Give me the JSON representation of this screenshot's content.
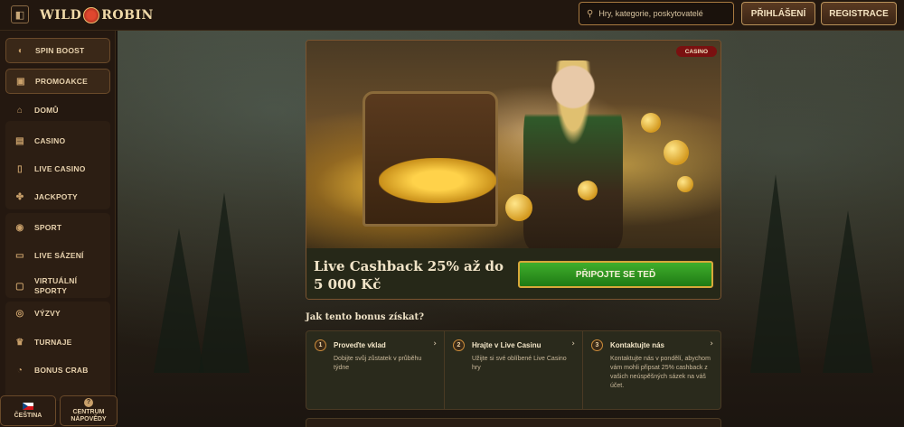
{
  "header": {
    "logo_text_left": "WILD",
    "logo_text_right": "ROBIN",
    "search_placeholder": "Hry, kategorie, poskytovatelé",
    "login_label": "PŘIHLÁŠENÍ",
    "register_label": "REGISTRACE"
  },
  "sidebar": {
    "items": [
      {
        "label": "SPIN BOOST",
        "icon": "spin-icon"
      },
      {
        "label": "PROMOAKCE",
        "icon": "gift-icon"
      },
      {
        "label": "DOMŮ",
        "icon": "home-icon"
      },
      {
        "label": "CASINO",
        "icon": "slot-icon"
      },
      {
        "label": "LIVE CASINO",
        "icon": "cards-icon"
      },
      {
        "label": "JACKPOTY",
        "icon": "jackpot-icon"
      },
      {
        "label": "SPORT",
        "icon": "ball-icon"
      },
      {
        "label": "LIVE SÁZENÍ",
        "icon": "live-icon"
      },
      {
        "label": "VIRTUÁLNÍ SPORTY",
        "icon": "virtual-icon"
      },
      {
        "label": "VÝZVY",
        "icon": "target-icon"
      },
      {
        "label": "TURNAJE",
        "icon": "trophy-icon"
      },
      {
        "label": "BONUS CRAB",
        "icon": "crab-icon"
      }
    ],
    "language_label": "ČEŠTINA",
    "help_label": "CENTRUM NÁPOVĚDY"
  },
  "promo": {
    "badge": "CASINO",
    "title": "Live Cashback 25% až do 5 000 Kč",
    "cta_label": "PŘIPOJTE SE TEĎ"
  },
  "howto": {
    "title": "Jak tento bonus získat?",
    "steps": [
      {
        "num": "1",
        "title": "Proveďte vklad",
        "text": "Dobijte svůj zůstatek v průběhu týdne"
      },
      {
        "num": "2",
        "title": "Hrajte v Live Casinu",
        "text": "Užijte si své oblíbené Live Casino hry"
      },
      {
        "num": "3",
        "title": "Kontaktujte nás",
        "text": "Kontaktujte nás v pondělí, abychom vám mohli připsat 25% cashback z vašich neúspěšných sázek na váš účet."
      }
    ]
  }
}
